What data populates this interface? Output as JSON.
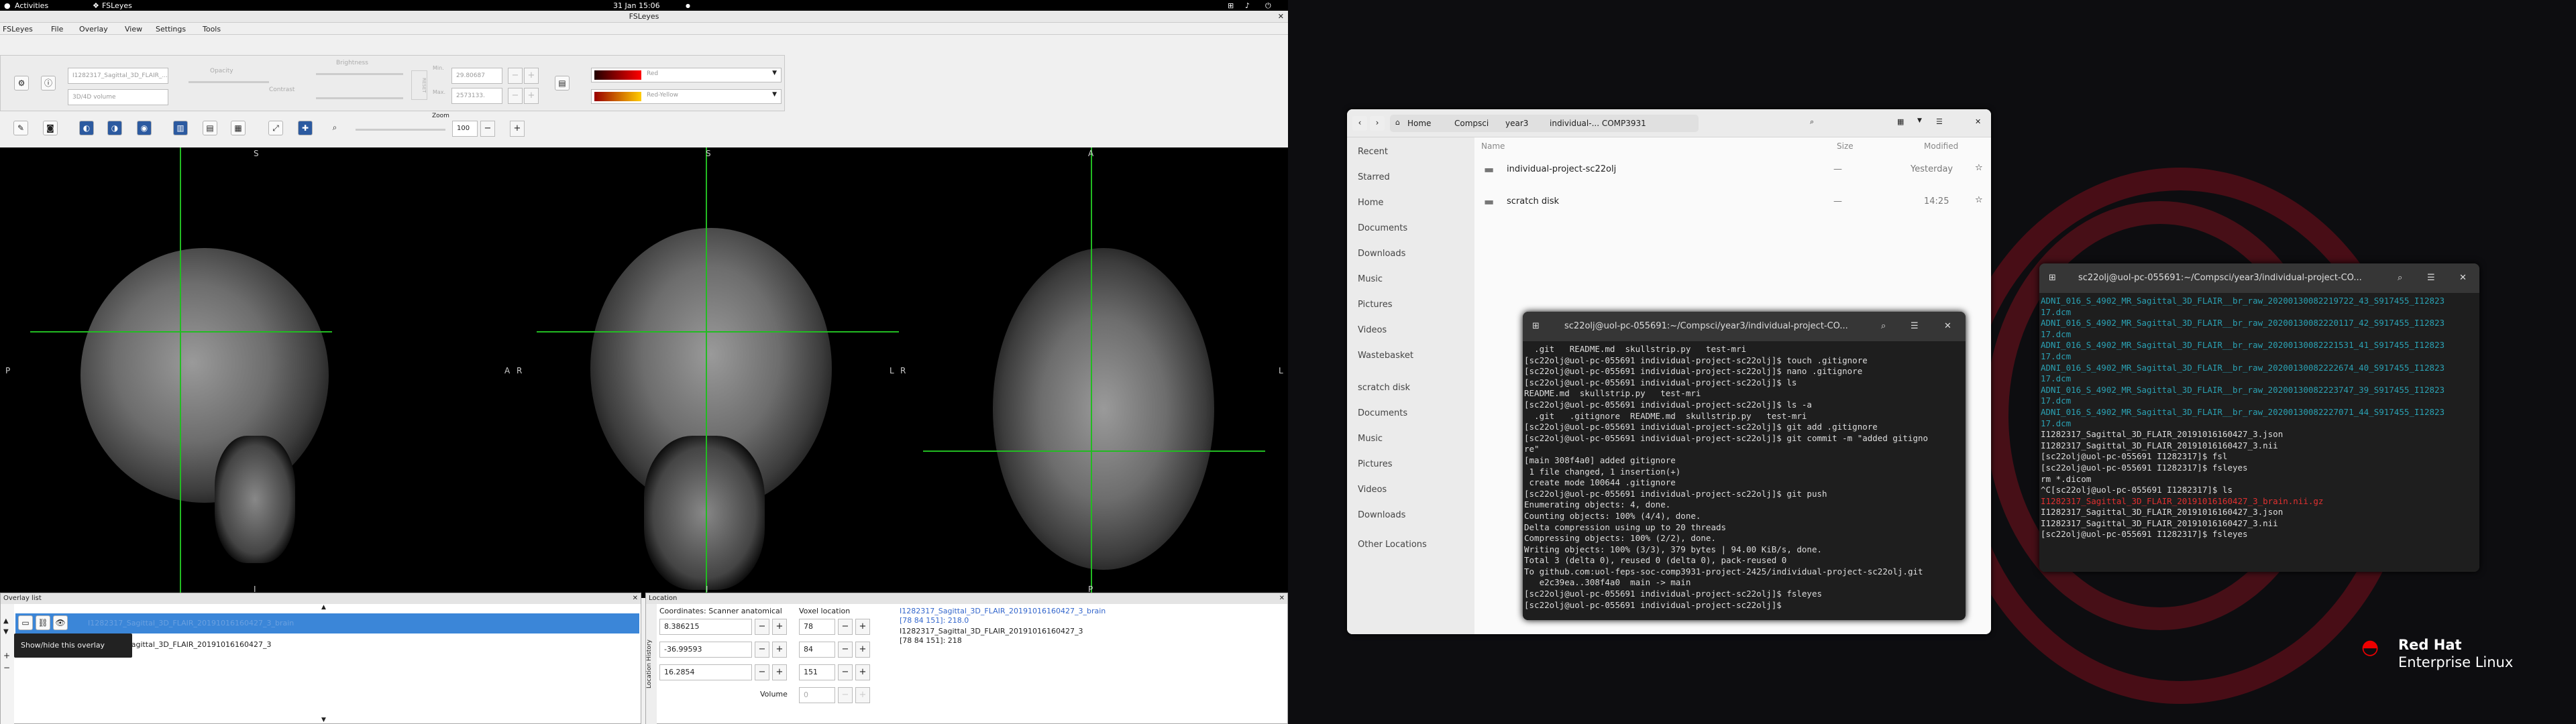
{
  "topbar": {
    "activities": "Activities",
    "app": "FSLeyes",
    "clock": "31 Jan  15:06"
  },
  "fsleyes": {
    "window_title": "FSLeyes",
    "menu": [
      "FSLeyes",
      "File",
      "Overlay",
      "View",
      "Settings",
      "Tools"
    ],
    "overlay_name": "I1282317_Sagittal_3D_FLAIR_...",
    "overlay_type": "3D/4D volume",
    "opacity_label": "Opacity",
    "brightness_label": "Brightness",
    "contrast_label": "Contrast",
    "reset_label": "RESET",
    "min_label": "Min.",
    "max_label": "Max.",
    "min_value": "29.80687",
    "max_value": "2573133.",
    "cmap1": "Red",
    "cmap2": "Red-Yellow",
    "zoom_label": "Zoom",
    "zoom_value": "100",
    "view_labels": {
      "sag_top": "S",
      "sag_left": "P",
      "sag_bottom": "I",
      "cor_top": "S",
      "cor_left": "A",
      "cor_right": "R",
      "cor_bottom": "I",
      "ax_top": "A",
      "ax_left": "L",
      "ax_right": "R",
      "ax_far": "L",
      "ax_bottom": "P"
    },
    "overlay_list": {
      "title": "Overlay list",
      "item1": "I1282317_Sagittal_3D_FLAIR_20191016160427_3_brain",
      "item2": "I1282317_Sagittal_3D_FLAIR_20191016160427_3",
      "tooltip": "Show/hide this overlay"
    },
    "location": {
      "title": "Location",
      "coord_label": "Coordinates: Scanner anatomical",
      "voxel_label": "Voxel location",
      "coords": [
        "8.386215",
        "-36.99593",
        "16.2854"
      ],
      "voxels": [
        "78",
        "84",
        "151"
      ],
      "volume_label": "Volume",
      "volume_value": "0",
      "info1_name": "I1282317_Sagittal_3D_FLAIR_20191016160427_3_brain",
      "info1_val": "[78 84 151]: 218.0",
      "info2_name": "I1282317_Sagittal_3D_FLAIR_20191016160427_3",
      "info2_val": "[78 84 151]: 218"
    }
  },
  "files": {
    "path": [
      "Home",
      "Compsci",
      "year3",
      "individual-... COMP3931"
    ],
    "sidebar": [
      "Recent",
      "Starred",
      "Home",
      "Documents",
      "Downloads",
      "Music",
      "Pictures",
      "Videos",
      "Wastebasket",
      "scratch disk",
      "Documents",
      "Music",
      "Pictures",
      "Videos",
      "Downloads",
      "Other Locations"
    ],
    "col_name": "Name",
    "col_size": "Size",
    "col_modified": "Modified",
    "rows": [
      {
        "name": "individual-project-sc22olj",
        "size": "—",
        "modified": "Yesterday"
      },
      {
        "name": "scratch disk",
        "size": "—",
        "modified": "14:25"
      }
    ]
  },
  "term1": {
    "title": "sc22olj@uol-pc-055691:~/Compsci/year3/individual-project-CO...",
    "lines": [
      "  .git   README.md  skullstrip.py   test-mri",
      "[sc22olj@uol-pc-055691 individual-project-sc22olj]$ touch .gitignore",
      "[sc22olj@uol-pc-055691 individual-project-sc22olj]$ nano .gitignore",
      "[sc22olj@uol-pc-055691 individual-project-sc22olj]$ ls",
      "README.md  skullstrip.py   test-mri",
      "[sc22olj@uol-pc-055691 individual-project-sc22olj]$ ls -a",
      "  .git   .gitignore  README.md  skullstrip.py   test-mri",
      "[sc22olj@uol-pc-055691 individual-project-sc22olj]$ git add .gitignore",
      "[sc22olj@uol-pc-055691 individual-project-sc22olj]$ git commit -m \"added gitigno",
      "re\"",
      "[main 308f4a0] added gitignore",
      " 1 file changed, 1 insertion(+)",
      " create mode 100644 .gitignore",
      "[sc22olj@uol-pc-055691 individual-project-sc22olj]$ git push",
      "Enumerating objects: 4, done.",
      "Counting objects: 100% (4/4), done.",
      "Delta compression using up to 20 threads",
      "Compressing objects: 100% (2/2), done.",
      "Writing objects: 100% (3/3), 379 bytes | 94.00 KiB/s, done.",
      "Total 3 (delta 0), reused 0 (delta 0), pack-reused 0",
      "To github.com:uol-feps-soc-comp3931-project-2425/individual-project-sc22olj.git",
      "   e2c39ea..308f4a0  main -> main",
      "[sc22olj@uol-pc-055691 individual-project-sc22olj]$ fsleyes",
      "[sc22olj@uol-pc-055691 individual-project-sc22olj]$ "
    ]
  },
  "term2": {
    "title": "sc22olj@uol-pc-055691:~/Compsci/year3/individual-project-CO...",
    "lines": [
      "ADNI_016_S_4902_MR_Sagittal_3D_FLAIR__br_raw_20200130082219722_43_S917455_I12823",
      "17.dcm",
      "ADNI_016_S_4902_MR_Sagittal_3D_FLAIR__br_raw_20200130082220117_42_S917455_I12823",
      "17.dcm",
      "ADNI_016_S_4902_MR_Sagittal_3D_FLAIR__br_raw_20200130082221531_41_S917455_I12823",
      "17.dcm",
      "ADNI_016_S_4902_MR_Sagittal_3D_FLAIR__br_raw_20200130082222674_40_S917455_I12823",
      "17.dcm",
      "ADNI_016_S_4902_MR_Sagittal_3D_FLAIR__br_raw_20200130082223747_39_S917455_I12823",
      "17.dcm",
      "ADNI_016_S_4902_MR_Sagittal_3D_FLAIR__br_raw_20200130082227071_44_S917455_I12823",
      "17.dcm",
      "I1282317_Sagittal_3D_FLAIR_20191016160427_3.json",
      "I1282317_Sagittal_3D_FLAIR_20191016160427_3.nii",
      "[sc22olj@uol-pc-055691 I1282317]$ fsl",
      "[sc22olj@uol-pc-055691 I1282317]$ fsleyes",
      "rm *.dicom",
      "",
      "^C[sc22olj@uol-pc-055691 I1282317]$ ls",
      "I1282317_Sagittal_3D_FLAIR_20191016160427_3_brain.nii.gz",
      "I1282317_Sagittal_3D_FLAIR_20191016160427_3.json",
      "I1282317_Sagittal_3D_FLAIR_20191016160427_3.nii",
      "[sc22olj@uol-pc-055691 I1282317]$ fsleyes",
      ""
    ]
  },
  "redhat": {
    "line1": "Red Hat",
    "line2": "Enterprise Linux"
  }
}
